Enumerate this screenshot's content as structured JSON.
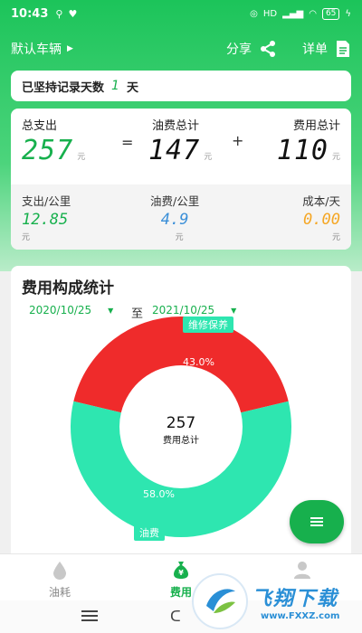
{
  "status_bar": {
    "time": "10:43",
    "battery": "65"
  },
  "header": {
    "vehicle": "默认车辆",
    "share": "分享",
    "details": "详单"
  },
  "streak": {
    "prefix": "已坚持记录天数",
    "days": "1",
    "suffix": "天"
  },
  "summary": {
    "total_label": "总支出",
    "total_value": "257",
    "total_unit": "元",
    "equals": "=",
    "fuel_label": "油费总计",
    "fuel_value": "147",
    "fuel_unit": "元",
    "plus": "+",
    "fee_label": "费用总计",
    "fee_value": "110",
    "fee_unit": "元",
    "per_km_label": "支出/公里",
    "per_km_value": "12.85",
    "per_km_unit": "元",
    "fuel_per_km_label": "油费/公里",
    "fuel_per_km_value": "4.9",
    "fuel_per_km_unit": "元",
    "daily_label": "成本/天",
    "daily_value": "0.00",
    "daily_unit": "元"
  },
  "composition": {
    "title": "费用构成统计",
    "start_date": "2020/10/25",
    "to": "至",
    "end_date": "2021/10/25",
    "center_value": "257",
    "center_label": "费用总计"
  },
  "chart_data": {
    "type": "pie",
    "categories": [
      "维修保养",
      "油费"
    ],
    "values": [
      43.0,
      58.0
    ],
    "labels": [
      "43.0%",
      "58.0%"
    ],
    "colors": [
      "#ef2b2b",
      "#2ee6b0"
    ]
  },
  "tabs": [
    {
      "label": "油耗"
    },
    {
      "label": "费用"
    },
    {
      "label": ""
    }
  ],
  "watermark": {
    "text": "飞翔下载",
    "url": "www.FXXZ.com"
  },
  "colors": {
    "brand": "#17b04d",
    "repair": "#ef2b2b",
    "fuel": "#2ee6b0",
    "blue": "#3b8fd8",
    "orange": "#f5a623"
  }
}
